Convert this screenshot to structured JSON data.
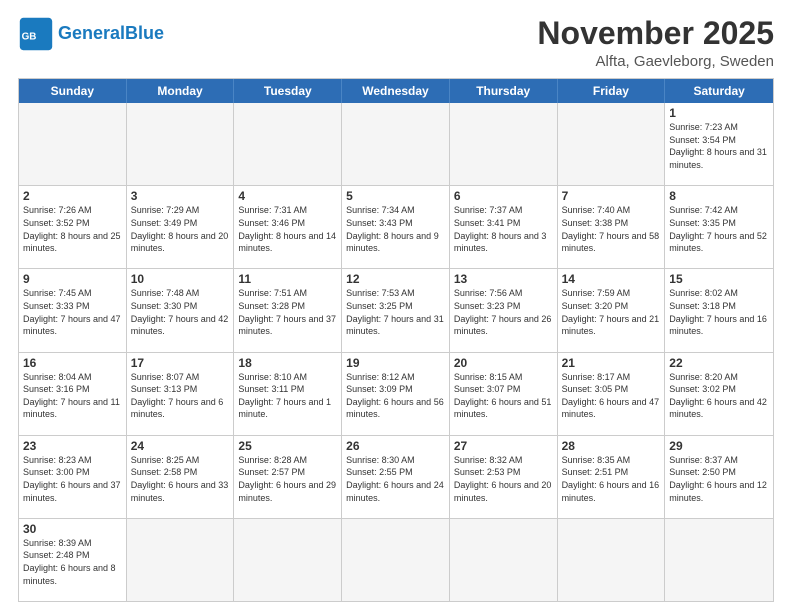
{
  "header": {
    "logo_general": "General",
    "logo_blue": "Blue",
    "title": "November 2025",
    "subtitle": "Alfta, Gaevleborg, Sweden"
  },
  "days_of_week": [
    "Sunday",
    "Monday",
    "Tuesday",
    "Wednesday",
    "Thursday",
    "Friday",
    "Saturday"
  ],
  "weeks": [
    [
      {
        "day": "",
        "info": "",
        "empty": true
      },
      {
        "day": "",
        "info": "",
        "empty": true
      },
      {
        "day": "",
        "info": "",
        "empty": true
      },
      {
        "day": "",
        "info": "",
        "empty": true
      },
      {
        "day": "",
        "info": "",
        "empty": true
      },
      {
        "day": "",
        "info": "",
        "empty": true
      },
      {
        "day": "1",
        "info": "Sunrise: 7:23 AM\nSunset: 3:54 PM\nDaylight: 8 hours and 31 minutes.",
        "empty": false
      }
    ],
    [
      {
        "day": "2",
        "info": "Sunrise: 7:26 AM\nSunset: 3:52 PM\nDaylight: 8 hours and 25 minutes.",
        "empty": false
      },
      {
        "day": "3",
        "info": "Sunrise: 7:29 AM\nSunset: 3:49 PM\nDaylight: 8 hours and 20 minutes.",
        "empty": false
      },
      {
        "day": "4",
        "info": "Sunrise: 7:31 AM\nSunset: 3:46 PM\nDaylight: 8 hours and 14 minutes.",
        "empty": false
      },
      {
        "day": "5",
        "info": "Sunrise: 7:34 AM\nSunset: 3:43 PM\nDaylight: 8 hours and 9 minutes.",
        "empty": false
      },
      {
        "day": "6",
        "info": "Sunrise: 7:37 AM\nSunset: 3:41 PM\nDaylight: 8 hours and 3 minutes.",
        "empty": false
      },
      {
        "day": "7",
        "info": "Sunrise: 7:40 AM\nSunset: 3:38 PM\nDaylight: 7 hours and 58 minutes.",
        "empty": false
      },
      {
        "day": "8",
        "info": "Sunrise: 7:42 AM\nSunset: 3:35 PM\nDaylight: 7 hours and 52 minutes.",
        "empty": false
      }
    ],
    [
      {
        "day": "9",
        "info": "Sunrise: 7:45 AM\nSunset: 3:33 PM\nDaylight: 7 hours and 47 minutes.",
        "empty": false
      },
      {
        "day": "10",
        "info": "Sunrise: 7:48 AM\nSunset: 3:30 PM\nDaylight: 7 hours and 42 minutes.",
        "empty": false
      },
      {
        "day": "11",
        "info": "Sunrise: 7:51 AM\nSunset: 3:28 PM\nDaylight: 7 hours and 37 minutes.",
        "empty": false
      },
      {
        "day": "12",
        "info": "Sunrise: 7:53 AM\nSunset: 3:25 PM\nDaylight: 7 hours and 31 minutes.",
        "empty": false
      },
      {
        "day": "13",
        "info": "Sunrise: 7:56 AM\nSunset: 3:23 PM\nDaylight: 7 hours and 26 minutes.",
        "empty": false
      },
      {
        "day": "14",
        "info": "Sunrise: 7:59 AM\nSunset: 3:20 PM\nDaylight: 7 hours and 21 minutes.",
        "empty": false
      },
      {
        "day": "15",
        "info": "Sunrise: 8:02 AM\nSunset: 3:18 PM\nDaylight: 7 hours and 16 minutes.",
        "empty": false
      }
    ],
    [
      {
        "day": "16",
        "info": "Sunrise: 8:04 AM\nSunset: 3:16 PM\nDaylight: 7 hours and 11 minutes.",
        "empty": false
      },
      {
        "day": "17",
        "info": "Sunrise: 8:07 AM\nSunset: 3:13 PM\nDaylight: 7 hours and 6 minutes.",
        "empty": false
      },
      {
        "day": "18",
        "info": "Sunrise: 8:10 AM\nSunset: 3:11 PM\nDaylight: 7 hours and 1 minute.",
        "empty": false
      },
      {
        "day": "19",
        "info": "Sunrise: 8:12 AM\nSunset: 3:09 PM\nDaylight: 6 hours and 56 minutes.",
        "empty": false
      },
      {
        "day": "20",
        "info": "Sunrise: 8:15 AM\nSunset: 3:07 PM\nDaylight: 6 hours and 51 minutes.",
        "empty": false
      },
      {
        "day": "21",
        "info": "Sunrise: 8:17 AM\nSunset: 3:05 PM\nDaylight: 6 hours and 47 minutes.",
        "empty": false
      },
      {
        "day": "22",
        "info": "Sunrise: 8:20 AM\nSunset: 3:02 PM\nDaylight: 6 hours and 42 minutes.",
        "empty": false
      }
    ],
    [
      {
        "day": "23",
        "info": "Sunrise: 8:23 AM\nSunset: 3:00 PM\nDaylight: 6 hours and 37 minutes.",
        "empty": false
      },
      {
        "day": "24",
        "info": "Sunrise: 8:25 AM\nSunset: 2:58 PM\nDaylight: 6 hours and 33 minutes.",
        "empty": false
      },
      {
        "day": "25",
        "info": "Sunrise: 8:28 AM\nSunset: 2:57 PM\nDaylight: 6 hours and 29 minutes.",
        "empty": false
      },
      {
        "day": "26",
        "info": "Sunrise: 8:30 AM\nSunset: 2:55 PM\nDaylight: 6 hours and 24 minutes.",
        "empty": false
      },
      {
        "day": "27",
        "info": "Sunrise: 8:32 AM\nSunset: 2:53 PM\nDaylight: 6 hours and 20 minutes.",
        "empty": false
      },
      {
        "day": "28",
        "info": "Sunrise: 8:35 AM\nSunset: 2:51 PM\nDaylight: 6 hours and 16 minutes.",
        "empty": false
      },
      {
        "day": "29",
        "info": "Sunrise: 8:37 AM\nSunset: 2:50 PM\nDaylight: 6 hours and 12 minutes.",
        "empty": false
      }
    ],
    [
      {
        "day": "30",
        "info": "Sunrise: 8:39 AM\nSunset: 2:48 PM\nDaylight: 6 hours and 8 minutes.",
        "empty": false
      },
      {
        "day": "",
        "info": "",
        "empty": true
      },
      {
        "day": "",
        "info": "",
        "empty": true
      },
      {
        "day": "",
        "info": "",
        "empty": true
      },
      {
        "day": "",
        "info": "",
        "empty": true
      },
      {
        "day": "",
        "info": "",
        "empty": true
      },
      {
        "day": "",
        "info": "",
        "empty": true
      }
    ]
  ]
}
